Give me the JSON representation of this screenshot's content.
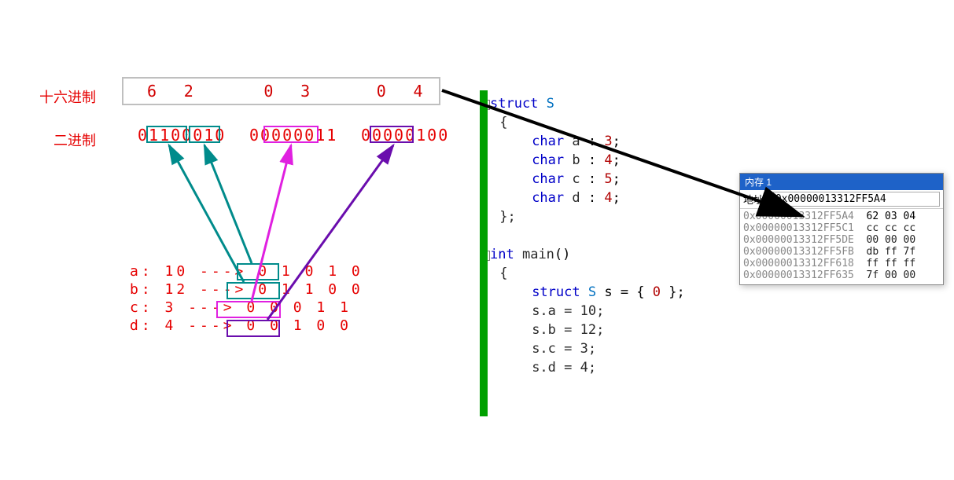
{
  "hex_label": "十六进制",
  "bin_label": "二进制",
  "hex_digits": [
    "6",
    "2",
    "0",
    "3",
    "0",
    "4"
  ],
  "binary_groups": [
    "01100010",
    "00000011",
    "00000100"
  ],
  "vars": [
    {
      "name": "a",
      "val": "10",
      "bits": "0 1 0 1 0",
      "box": "teal"
    },
    {
      "name": "b",
      "val": "12",
      "bits": "0 1 1 0 0",
      "box": "teal"
    },
    {
      "name": "c",
      "val": "3",
      "bits": "0 0 0 1 1",
      "box": "magenta"
    },
    {
      "name": "d",
      "val": "4",
      "bits": "0 0 1 0 0",
      "box": "purple"
    }
  ],
  "code": {
    "struct_kw": "struct",
    "struct_name": "S",
    "char_kw": "char",
    "fields": [
      {
        "n": "a",
        "b": "3"
      },
      {
        "n": "b",
        "b": "4"
      },
      {
        "n": "c",
        "b": "5"
      },
      {
        "n": "d",
        "b": "4"
      }
    ],
    "int_kw": "int",
    "main": "main",
    "decl": "struct S s = { 0 };",
    "assigns": [
      "s.a = 10;",
      "s.b = 12;",
      "s.c = 3;",
      "s.d = 4;"
    ]
  },
  "mem": {
    "title": "内存 1",
    "addr_label": "地址:",
    "addr_value": "0x00000013312FF5A4",
    "rows": [
      {
        "a": "0x00000013312FF5A4",
        "b": "62 03 04",
        "active": true
      },
      {
        "a": "0x00000013312FF5C1",
        "b": "cc cc cc"
      },
      {
        "a": "0x00000013312FF5DE",
        "b": "00 00 00"
      },
      {
        "a": "0x00000013312FF5FB",
        "b": "db ff 7f"
      },
      {
        "a": "0x00000013312FF618",
        "b": "ff ff ff"
      },
      {
        "a": "0x00000013312FF635",
        "b": "7f 00 00"
      }
    ]
  }
}
